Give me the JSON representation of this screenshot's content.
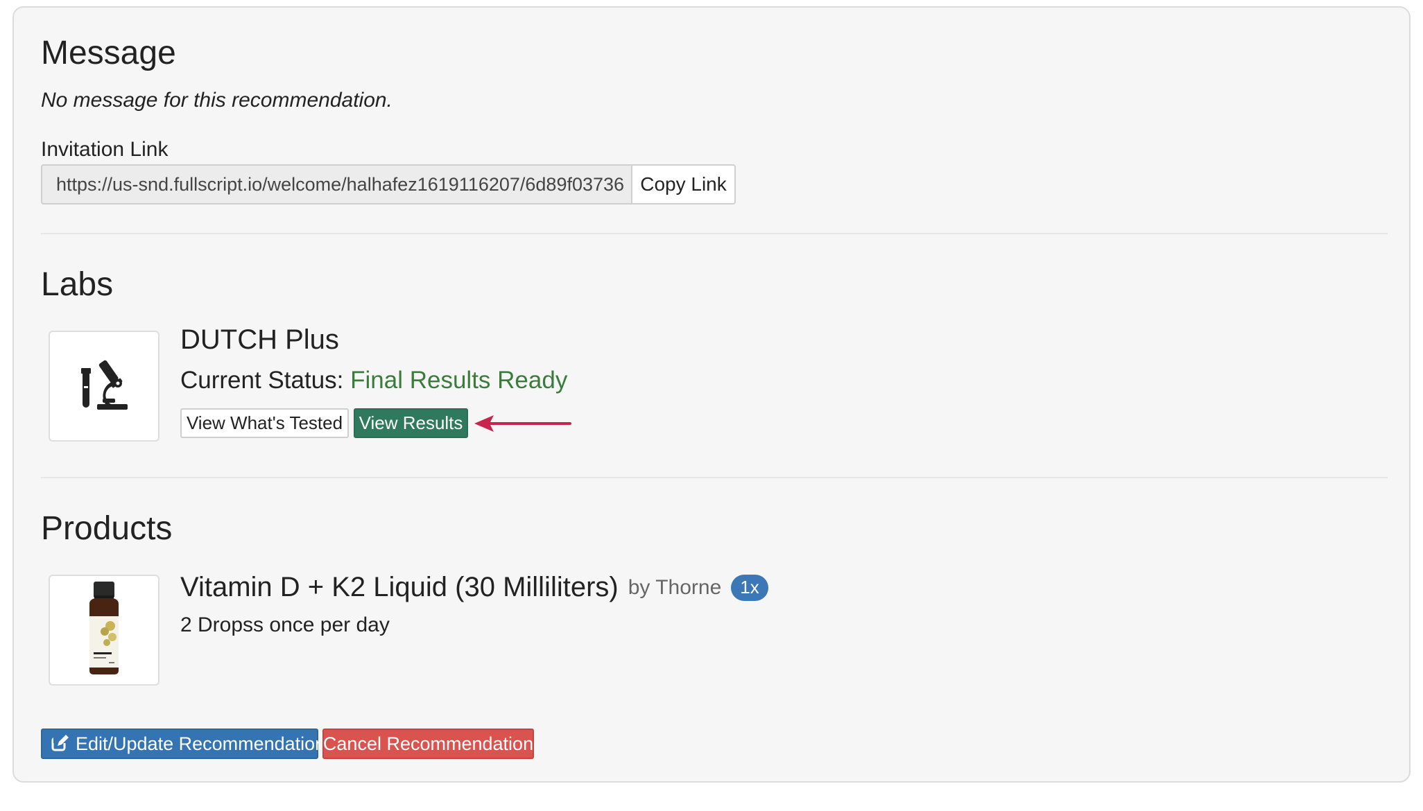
{
  "message": {
    "heading": "Message",
    "body": "No message for this recommendation."
  },
  "invitation": {
    "label": "Invitation Link",
    "url": "https://us-snd.fullscript.io/welcome/halhafez1619116207/6d89f03736",
    "copy_label": "Copy Link"
  },
  "labs": {
    "heading": "Labs",
    "items": [
      {
        "name": "DUTCH Plus",
        "status_prefix": "Current Status:",
        "status_value": "Final Results Ready",
        "view_tested_label": "View What's Tested",
        "view_results_label": "View Results",
        "icon": "lab-microscope-icon"
      }
    ]
  },
  "products": {
    "heading": "Products",
    "items": [
      {
        "name": "Vitamin D + K2 Liquid (30 Milliliters)",
        "brand": "by Thorne",
        "quantity_badge": "1x",
        "dosage": "2 Dropss once per day",
        "image": "thorne-bottle-image"
      }
    ]
  },
  "actions": {
    "edit_label": "Edit/Update Recommendation",
    "cancel_label": "Cancel Recommendation",
    "edit_icon": "edit-icon"
  },
  "annotation": {
    "arrow_color": "#c7254e",
    "icon": "pointer-arrow-icon"
  },
  "colors": {
    "status_ok": "#3a7d3a",
    "primary_green": "#2f7a5f",
    "primary_blue": "#3474b3",
    "danger_red": "#d9534f",
    "badge_blue": "#3c78b5"
  }
}
